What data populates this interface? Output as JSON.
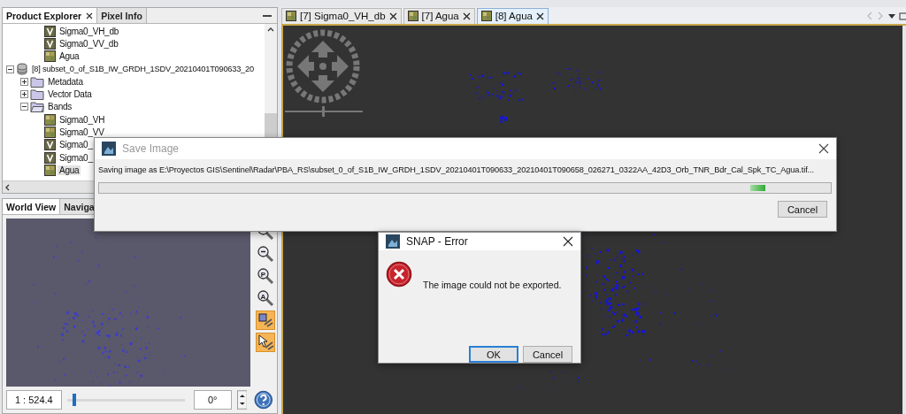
{
  "explorer": {
    "tabs": [
      {
        "label": "Product Explorer",
        "selected": true,
        "closable": true
      },
      {
        "label": "Pixel Info",
        "selected": false,
        "closable": false
      }
    ],
    "tree": {
      "earlier_bands": [
        {
          "label": "Sigma0_VH_db",
          "kind": "virtual",
          "selected": false
        },
        {
          "label": "Sigma0_VV_db",
          "kind": "virtual",
          "selected": false
        },
        {
          "label": "Agua",
          "kind": "band",
          "selected": false
        }
      ],
      "products": [
        {
          "label": "[8] subset_0_of_S1B_IW_GRDH_1SDV_20210401T090633_20",
          "kind": "product",
          "expanded": true,
          "children": [
            {
              "label": "Metadata",
              "kind": "folder",
              "expanded": false
            },
            {
              "label": "Vector Data",
              "kind": "folder",
              "expanded": false
            },
            {
              "label": "Bands",
              "kind": "folder",
              "expanded": true,
              "children": [
                {
                  "label": "Sigma0_VH",
                  "kind": "band",
                  "selected": false
                },
                {
                  "label": "Sigma0_VV",
                  "kind": "band",
                  "selected": false
                },
                {
                  "label": "Sigma0_",
                  "kind": "virtual",
                  "selected": false
                },
                {
                  "label": "Sigma0_",
                  "kind": "virtual",
                  "selected": false
                },
                {
                  "label": "Agua",
                  "kind": "band",
                  "selected": true
                }
              ]
            }
          ]
        }
      ]
    }
  },
  "world_view": {
    "tabs": [
      {
        "label": "World View",
        "selected": true
      },
      {
        "label": "Naviga",
        "selected": false
      }
    ],
    "tools": [
      {
        "kind": "zoom-in"
      },
      {
        "kind": "zoom-out"
      },
      {
        "kind": "zoom-letter",
        "glyph": "P"
      },
      {
        "kind": "zoom-letter",
        "glyph": "A"
      },
      {
        "kind": "sync-views",
        "on": true
      },
      {
        "kind": "sync-cursor",
        "on": true
      }
    ],
    "scale": "1 : 524.4",
    "zoom": {
      "level": 0.05
    },
    "rotation": "0°"
  },
  "editor": {
    "tabs": [
      {
        "label": "[7] Sigma0_VH_db",
        "selected": false
      },
      {
        "label": "[7] Agua",
        "selected": false
      },
      {
        "label": "[8] Agua",
        "selected": true
      }
    ]
  },
  "save_dialog": {
    "title": "Save Image",
    "active": false,
    "progress": {
      "level": 0.91
    },
    "message": "Saving image as E:\\Proyectos GIS\\Sentinel\\Radar\\PBA_RS\\subset_0_of_S1B_IW_GRDH_1SDV_20210401T090633_20210401T090658_026271_0322AA_42D3_Orb_TNR_Bdr_Cal_Spk_TC_Agua.tif...",
    "buttons": [
      "Cancel"
    ]
  },
  "error_dialog": {
    "title": "SNAP - Error",
    "message": "The image could not be exported.",
    "buttons": [
      {
        "label": "OK",
        "focused": true
      },
      {
        "label": "Cancel",
        "focused": false
      }
    ]
  }
}
